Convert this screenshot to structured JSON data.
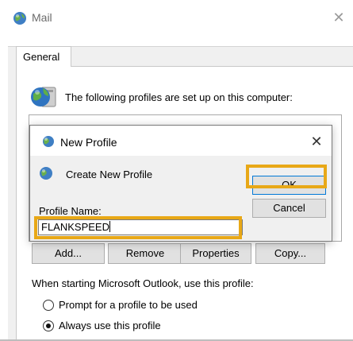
{
  "mail_window": {
    "title": "Mail",
    "tab": "General",
    "profiles_text": "The following profiles are set up on this computer:",
    "buttons": {
      "add": "Add...",
      "remove": "Remove",
      "properties": "Properties",
      "copy": "Copy..."
    },
    "startup_text": "When starting Microsoft Outlook, use this profile:",
    "radio_prompt": "Prompt for a profile to be used",
    "radio_always": "Always use this profile",
    "selected_option": "Always use this profile"
  },
  "dialog": {
    "title": "New Profile",
    "header": "Create New Profile",
    "profile_name_label": "Profile Name:",
    "profile_name_value": "FLANKSPEED",
    "ok_label": "OK",
    "cancel_label": "Cancel"
  },
  "colors": {
    "highlight": "#e8a817",
    "accent": "#0078d7"
  },
  "icons": {
    "mail": "mail-globe-icon",
    "profiles": "profiles-globe-icon",
    "close": "close-icon"
  }
}
